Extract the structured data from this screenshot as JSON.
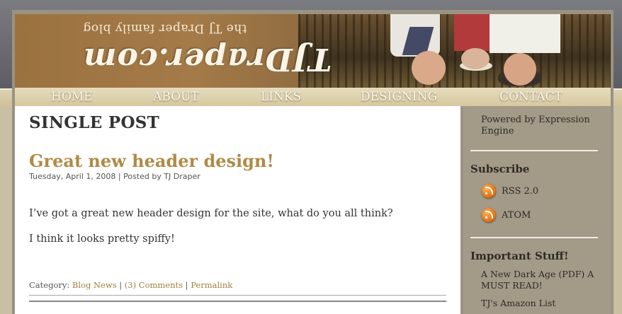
{
  "header": {
    "tagline": "the TJ Draper family blog",
    "logo": "TJDraper.com"
  },
  "nav": {
    "items": [
      "HOME",
      "ABOUT",
      "LINKS",
      "DESIGNING",
      "CONTACT"
    ]
  },
  "main": {
    "section_title": "SINGLE POST",
    "post": {
      "title": "Great new header design!",
      "meta": "Tuesday, April 1, 2008 | Posted by TJ Draper",
      "body": [
        "I’ve got a great new header design for the site, what do you all think?",
        "I think it looks pretty spiffy!"
      ],
      "footer": {
        "category_label": "Category:",
        "category": "Blog News",
        "sep1": "|",
        "comments": "(3) Comments",
        "sep2": "|",
        "permalink": "Permalink"
      }
    }
  },
  "sidebar": {
    "powered_by": "Powered by Expression Engine",
    "subscribe_title": "Subscribe",
    "feeds": [
      "RSS 2.0",
      "ATOM"
    ],
    "important_title": "Important Stuff!",
    "links": [
      "A New Dark Age (PDF) A MUST READ!",
      "TJ's Amazon List"
    ]
  },
  "colors": {
    "accent": "#b08a45",
    "link": "#a07f3e",
    "sidebar_bg": "#a39a88",
    "nav_bg": "#d6c89f"
  },
  "icons": {
    "feed_icon": "rss-feed-icon"
  }
}
